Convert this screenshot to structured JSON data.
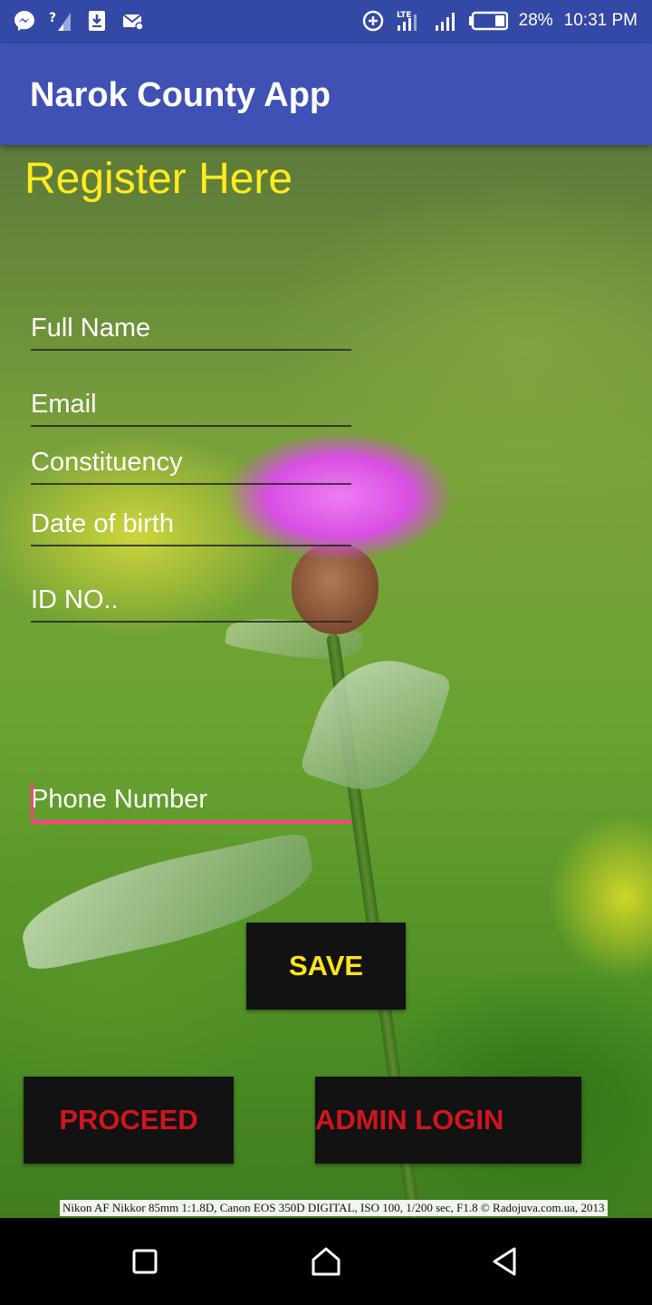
{
  "status_bar": {
    "left_icons": [
      "messenger-icon",
      "wifi-unknown-icon",
      "download-icon",
      "mail-settings-icon"
    ],
    "right_icons": [
      "data-saver-icon",
      "lte-signal-icon",
      "signal-icon",
      "battery-icon"
    ],
    "network_label": "LTE",
    "battery_percent": "28%",
    "time": "10:31 PM"
  },
  "app_bar": {
    "title": "Narok County App",
    "color": "#3f51b5"
  },
  "form": {
    "heading": "Register Here",
    "fields": [
      {
        "placeholder": "Full Name",
        "value": ""
      },
      {
        "placeholder": "Email",
        "value": ""
      },
      {
        "placeholder": "Constituency",
        "value": ""
      },
      {
        "placeholder": "Date of birth",
        "value": ""
      },
      {
        "placeholder": "ID NO..",
        "value": ""
      },
      {
        "placeholder": "Phone Number",
        "value": "",
        "focused": true
      }
    ]
  },
  "buttons": {
    "save": "SAVE",
    "proceed": "PROCEED",
    "admin_login": "ADMIN LOGIN"
  },
  "photo_credit": "Nikon AF Nikkor 85mm 1:1.8D, Canon EOS 350D DIGITAL, ISO 100, 1/200 sec, F1.8 © Radojuva.com.ua, 2013",
  "nav_bar": {
    "icons": [
      "recents-square-icon",
      "home-icon",
      "back-triangle-icon"
    ]
  },
  "colors": {
    "accent": "#ff4081",
    "heading_yellow": "#ffeb1f",
    "button_bg": "#121212",
    "save_text": "#ffe31a",
    "red_text": "#d0161d"
  }
}
